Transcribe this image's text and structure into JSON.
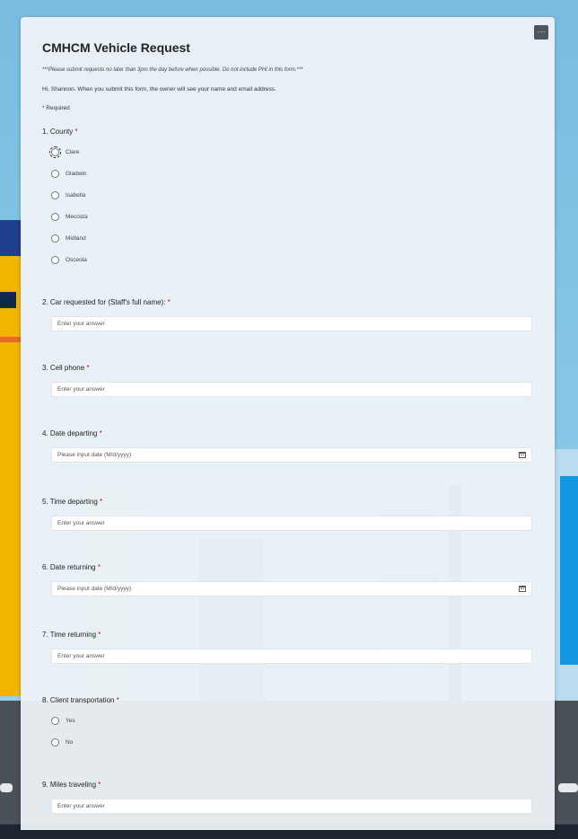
{
  "form": {
    "title": "CMHCM Vehicle Request",
    "notice": "***Please submit requests no later than 3pm the day before when possible. Do not include PHI in this form.***",
    "identity_note": "Hi, Shannon. When you submit this form, the owner will see your name and email address.",
    "required_star": "*",
    "required_note": "Required",
    "more_label": "···"
  },
  "questions": {
    "q1": {
      "label": "1. County",
      "options": [
        "Clare",
        "Gladwin",
        "Isabella",
        "Mecosta",
        "Midland",
        "Osceola"
      ]
    },
    "q2": {
      "label": "2. Car requested for (Staff's full name):",
      "placeholder": "Enter your answer"
    },
    "q3": {
      "label": "3. Cell phone",
      "placeholder": "Enter your answer"
    },
    "q4": {
      "label": "4. Date departing",
      "placeholder": "Please input date (M/d/yyyy)"
    },
    "q5": {
      "label": "5. Time departing",
      "placeholder": "Enter your answer"
    },
    "q6": {
      "label": "6. Date returning",
      "placeholder": "Please input date (M/d/yyyy)"
    },
    "q7": {
      "label": "7. Time returning",
      "placeholder": "Enter your answer"
    },
    "q8": {
      "label": "8. Client transportation",
      "options": [
        "Yes",
        "No"
      ]
    },
    "q9": {
      "label": "9. Miles traveling",
      "placeholder": "Enter your answer"
    }
  }
}
